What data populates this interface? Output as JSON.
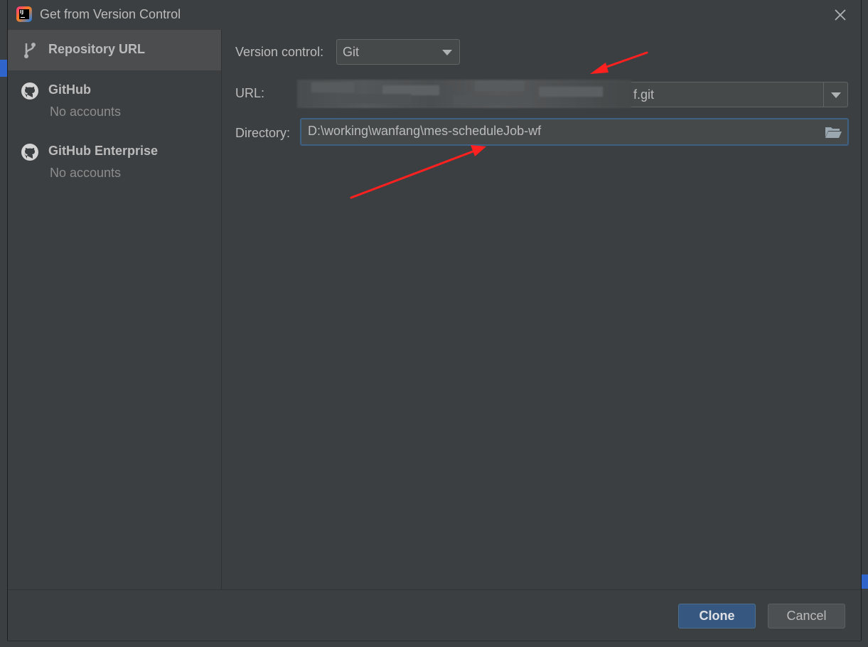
{
  "window": {
    "title": "Get from Version Control"
  },
  "sidebar": {
    "items": [
      {
        "label": "Repository URL",
        "sub": "",
        "selected": true,
        "icon": "git-branch-icon"
      },
      {
        "label": "GitHub",
        "sub": "No accounts",
        "selected": false,
        "icon": "github-icon"
      },
      {
        "label": "GitHub Enterprise",
        "sub": "No accounts",
        "selected": false,
        "icon": "github-icon"
      }
    ]
  },
  "form": {
    "version_control": {
      "label": "Version control:",
      "value": "Git"
    },
    "url": {
      "label": "URL:",
      "value_visible": "f.git"
    },
    "directory": {
      "label": "Directory:",
      "value": "D:\\working\\wanfang\\mes-scheduleJob-wf"
    }
  },
  "footer": {
    "clone_label": "Clone",
    "cancel_label": "Cancel"
  },
  "colors": {
    "background": "#3c3f41",
    "selected": "#4b4d4f",
    "primary_button": "#365880",
    "annotation_arrow": "#ff2222"
  }
}
